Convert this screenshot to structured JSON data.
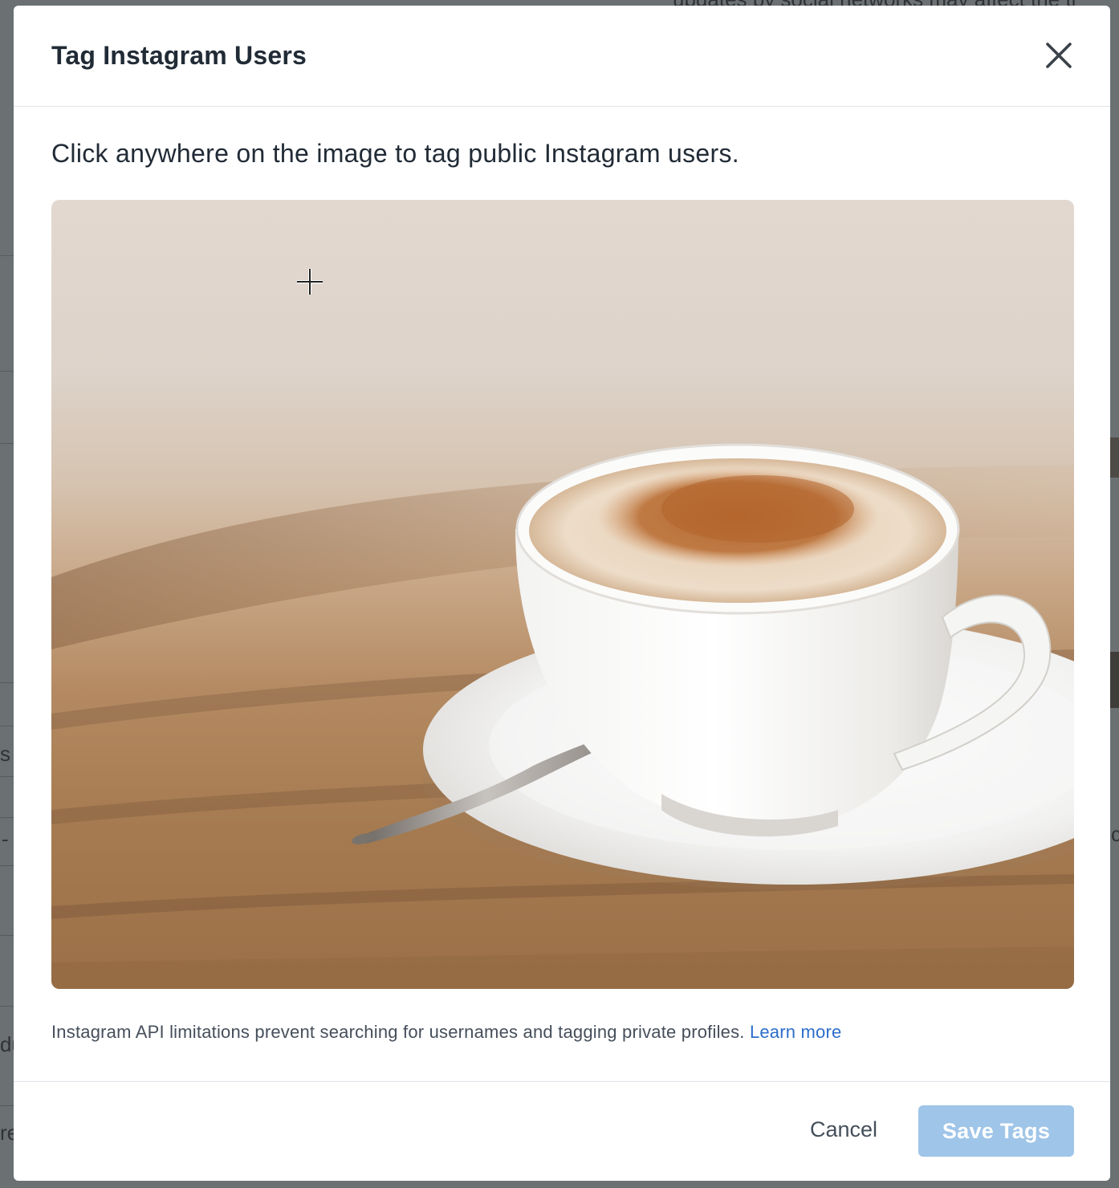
{
  "background": {
    "top_text": "updates by social networks may affect the ti",
    "fragments": [
      "s",
      "-",
      "du",
      "re",
      "c"
    ]
  },
  "modal": {
    "title": "Tag Instagram Users",
    "close_icon": "close-icon",
    "instructions": "Click anywhere on the image to tag public Instagram users.",
    "image": {
      "description_icon": "cursor-crosshair-icon"
    },
    "footnote": {
      "text": "Instagram API limitations prevent searching for usernames and tagging private profiles.",
      "link_label": "Learn more"
    },
    "footer": {
      "cancel_label": "Cancel",
      "save_label": "Save Tags",
      "save_enabled": false
    }
  },
  "colors": {
    "primary_disabled": "#9fc5e8",
    "link": "#2c6ecb",
    "title": "#212b36"
  }
}
